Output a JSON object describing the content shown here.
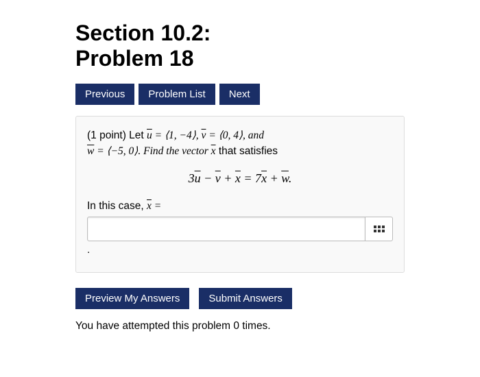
{
  "title": {
    "line1": "Section 10.2:",
    "line2": "Problem 18"
  },
  "nav": {
    "previous": "Previous",
    "problem_list": "Problem List",
    "next": "Next"
  },
  "problem": {
    "lead_a": "(1 point) Let ",
    "u_var": "u",
    "eq1": " = ⟨1, −4⟩, ",
    "v_var": "v",
    "eq2": " = ⟨0, 4⟩, and",
    "w_var": "w",
    "eq3": " = ⟨−5, 0⟩. Find the vector ",
    "x_var": "x",
    "eq4": " that satisfies",
    "equation_a": "3",
    "equation_u": "u",
    "equation_b": " − ",
    "equation_v": "v",
    "equation_c": " + ",
    "equation_x": "x",
    "equation_d": " = 7",
    "equation_x2": "x",
    "equation_e": " + ",
    "equation_w": "w",
    "equation_f": ".",
    "inthiscase_a": "In this case, ",
    "inthiscase_x": "x",
    "inthiscase_b": " ="
  },
  "answer": {
    "value": "",
    "placeholder": ""
  },
  "dot": ".",
  "actions": {
    "preview": "Preview My Answers",
    "submit": "Submit Answers"
  },
  "attempt_text": "You have attempted this problem 0 times.",
  "keyboard_icon_label": "keyboard"
}
